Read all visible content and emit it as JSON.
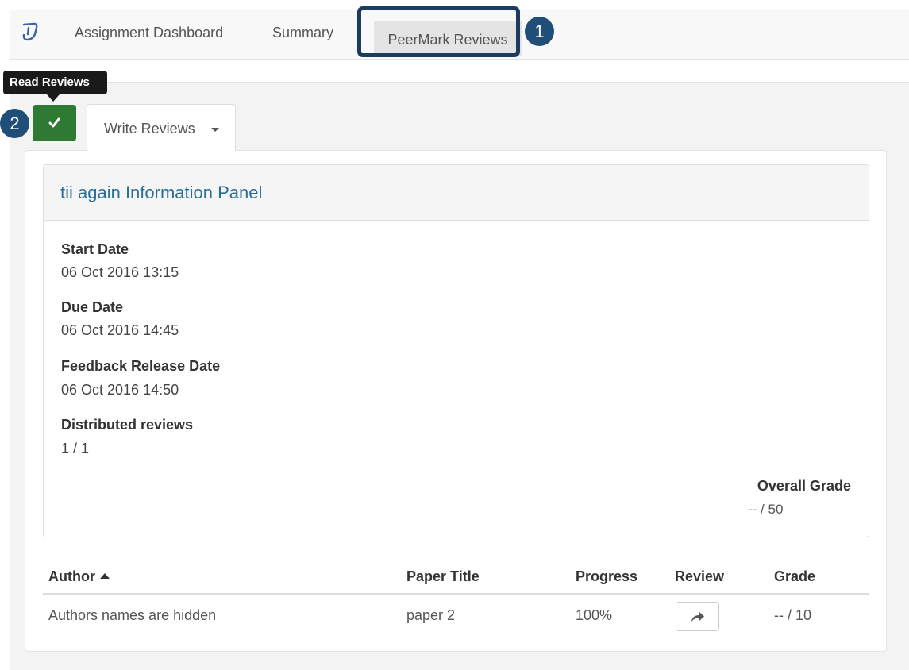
{
  "nav": {
    "items": [
      {
        "label": "Assignment Dashboard"
      },
      {
        "label": "Summary"
      },
      {
        "label": "PeerMark Reviews",
        "active": true
      }
    ]
  },
  "callouts": [
    "1",
    "2"
  ],
  "tooltip": "Read Reviews",
  "tabs": {
    "write_reviews": "Write Reviews"
  },
  "info_panel": {
    "title": "tii again Information Panel",
    "fields": [
      {
        "label": "Start Date",
        "value": "06 Oct 2016 13:15"
      },
      {
        "label": "Due Date",
        "value": "06 Oct 2016 14:45"
      },
      {
        "label": "Feedback Release Date",
        "value": "06 Oct 2016 14:50"
      },
      {
        "label": "Distributed reviews",
        "value": "1 / 1"
      }
    ],
    "overall_grade": {
      "label": "Overall Grade",
      "value": "-- / 50"
    }
  },
  "table": {
    "headers": [
      "Author",
      "Paper Title",
      "Progress",
      "Review",
      "Grade"
    ],
    "rows": [
      [
        "Authors names are hidden",
        "paper 2",
        "100%",
        "",
        "-- / 10"
      ]
    ]
  },
  "colors": {
    "accent": "#2e7a33",
    "callout": "#1f4e79",
    "title_link": "#2a6f97"
  },
  "icons": [
    "turnitin-logo-icon",
    "checkmark-icon",
    "caret-down-icon",
    "sort-up-icon",
    "share-arrow-icon"
  ]
}
